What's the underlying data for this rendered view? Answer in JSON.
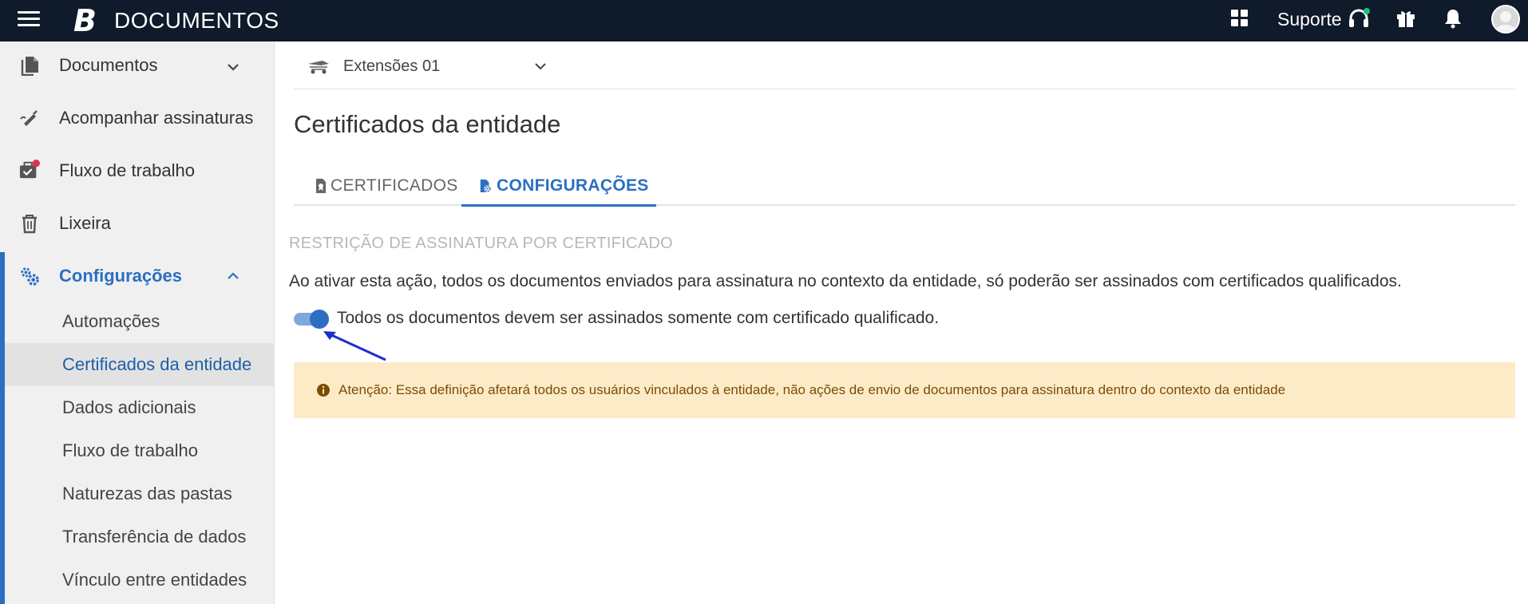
{
  "topbar": {
    "logo": "B",
    "app_title": "DOCUMENTOS",
    "support_label": "Suporte",
    "icons": [
      "menu-icon",
      "apps-grid-icon",
      "headset-icon",
      "gift-icon",
      "bell-icon",
      "avatar"
    ],
    "colors": {
      "background": "#0f1a2a",
      "online_dot": "#19c37d"
    }
  },
  "sidebar": {
    "items": [
      {
        "label": "Documentos",
        "icon": "documents-icon",
        "chevron": "down"
      },
      {
        "label": "Acompanhar assinaturas",
        "icon": "signature-pen-icon"
      },
      {
        "label": "Fluxo de trabalho",
        "icon": "briefcase-check-icon",
        "badge_color": "#e0334a"
      },
      {
        "label": "Lixeira",
        "icon": "trash-icon"
      },
      {
        "label": "Configurações",
        "icon": "gears-icon",
        "chevron": "up",
        "active": true
      }
    ],
    "config_subitems": [
      {
        "label": "Automações"
      },
      {
        "label": "Certificados da entidade",
        "active": true
      },
      {
        "label": "Dados adicionais"
      },
      {
        "label": "Fluxo de trabalho"
      },
      {
        "label": "Naturezas das pastas"
      },
      {
        "label": "Transferência de dados"
      },
      {
        "label": "Vínculo entre entidades"
      }
    ],
    "colors": {
      "accent": "#2b6fc1",
      "active_text": "#1e5fa8"
    }
  },
  "main": {
    "entity_selector": {
      "value": "Extensões 01",
      "icon": "entity-logo-icon"
    },
    "page_title": "Certificados da entidade",
    "tabs": [
      {
        "label": "CERTIFICADOS",
        "icon": "file-certificate-icon",
        "active": false
      },
      {
        "label": "CONFIGURAÇÕES",
        "icon": "file-settings-icon",
        "active": true
      }
    ],
    "section_heading": "RESTRIÇÃO DE ASSINATURA POR CERTIFICADO",
    "description": "Ao ativar esta ação, todos os documentos enviados para assinatura no contexto da entidade, só poderão ser assinados com certificados qualificados.",
    "toggle": {
      "label": "Todos os documentos devem ser assinados somente com certificado qualificado.",
      "checked": true
    },
    "alert": {
      "icon": "info-icon",
      "text": "Atenção: Essa definição afetará todos os usuários vinculados à entidade, não ações de envio de documentos para assinatura dentro do contexto da entidade",
      "colors": {
        "background": "#fdebc8",
        "text": "#7a4d05"
      }
    }
  }
}
